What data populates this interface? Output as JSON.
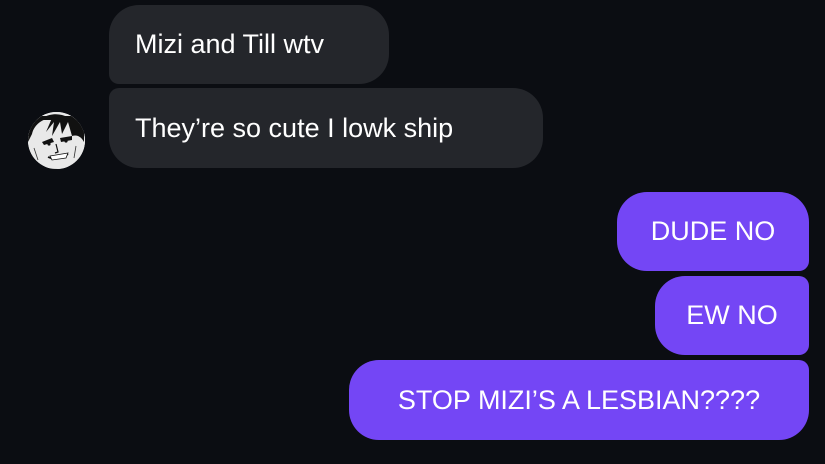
{
  "conversation": {
    "incoming": [
      {
        "text": "Mizi and Till wtv"
      },
      {
        "text": "They’re so cute I lowk ship"
      }
    ],
    "outgoing": [
      {
        "text": "DUDE NO"
      },
      {
        "text": "EW NO"
      },
      {
        "text": "STOP MIZI’S A LESBIAN????"
      }
    ]
  },
  "contact": {
    "avatar_icon": "manga-character-avatar-icon"
  },
  "colors": {
    "background": "#0b0d12",
    "incoming_bubble": "#24262b",
    "outgoing_bubble": "#7446f5",
    "text": "#ffffff"
  }
}
